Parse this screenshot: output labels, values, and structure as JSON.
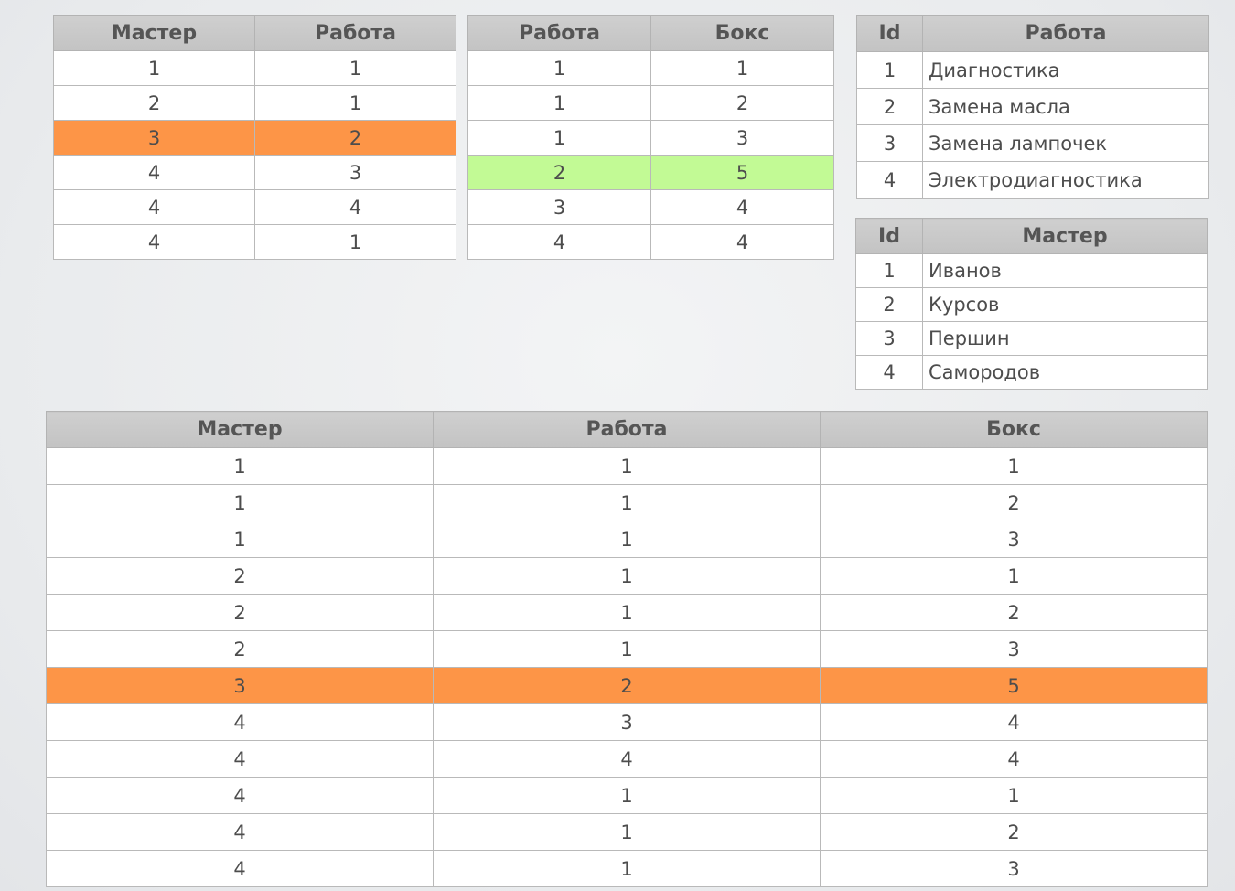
{
  "master_work": {
    "headers": [
      "Мастер",
      "Работа"
    ],
    "rows": [
      [
        "1",
        "1"
      ],
      [
        "2",
        "1"
      ],
      [
        "3",
        "2"
      ],
      [
        "4",
        "3"
      ],
      [
        "4",
        "4"
      ],
      [
        "4",
        "1"
      ]
    ],
    "highlight_row": 2,
    "highlight_color": "#fd9547"
  },
  "work_box": {
    "headers": [
      "Работа",
      "Бокс"
    ],
    "rows": [
      [
        "1",
        "1"
      ],
      [
        "1",
        "2"
      ],
      [
        "1",
        "3"
      ],
      [
        "2",
        "5"
      ],
      [
        "3",
        "4"
      ],
      [
        "4",
        "4"
      ]
    ],
    "highlight_row": 3,
    "highlight_color": "#c2fa95"
  },
  "works": {
    "headers": [
      "Id",
      "Работа"
    ],
    "rows": [
      [
        "1",
        "Диагностика"
      ],
      [
        "2",
        "Замена масла"
      ],
      [
        "3",
        "Замена лампочек"
      ],
      [
        "4",
        "Электродиагностика"
      ]
    ]
  },
  "masters": {
    "headers": [
      "Id",
      "Мастер"
    ],
    "rows": [
      [
        "1",
        "Иванов"
      ],
      [
        "2",
        "Курсов"
      ],
      [
        "3",
        "Першин"
      ],
      [
        "4",
        "Самородов"
      ]
    ]
  },
  "result": {
    "headers": [
      "Мастер",
      "Работа",
      "Бокс"
    ],
    "rows": [
      [
        "1",
        "1",
        "1"
      ],
      [
        "1",
        "1",
        "2"
      ],
      [
        "1",
        "1",
        "3"
      ],
      [
        "2",
        "1",
        "1"
      ],
      [
        "2",
        "1",
        "2"
      ],
      [
        "2",
        "1",
        "3"
      ],
      [
        "3",
        "2",
        "5"
      ],
      [
        "4",
        "3",
        "4"
      ],
      [
        "4",
        "4",
        "4"
      ],
      [
        "4",
        "1",
        "1"
      ],
      [
        "4",
        "1",
        "2"
      ],
      [
        "4",
        "1",
        "3"
      ]
    ],
    "highlight_row": 6,
    "highlight_color": "#fd9547"
  },
  "colors": {
    "header_bg": "#c8c8c8",
    "orange": "#fd9547",
    "green": "#c2fa95"
  }
}
